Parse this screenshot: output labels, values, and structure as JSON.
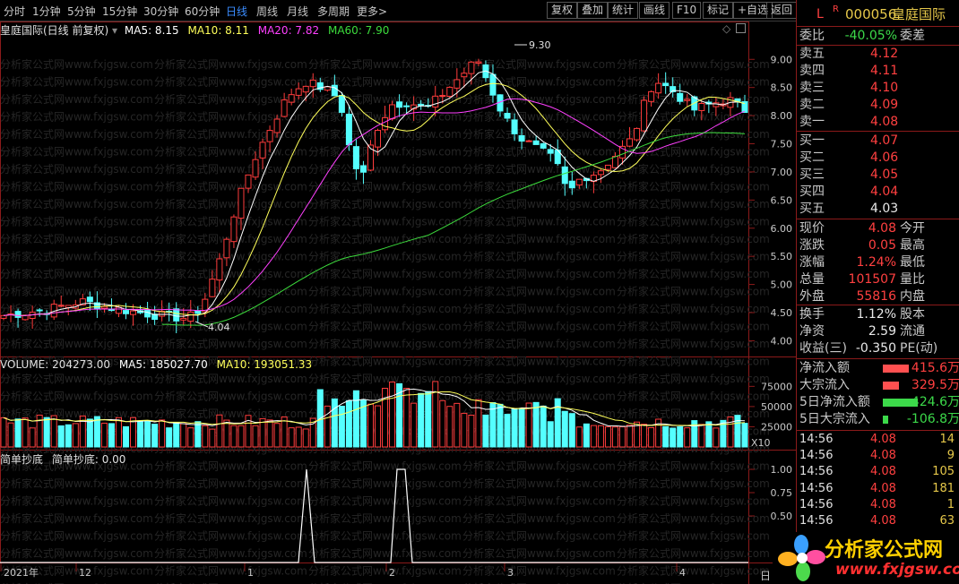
{
  "toolbar": {
    "tabs": [
      "分时",
      "1分钟",
      "5分钟",
      "15分钟",
      "30分钟",
      "60分钟",
      "日线",
      "周线",
      "月线",
      "多周期",
      "更多>"
    ],
    "active_tab": "日线",
    "right_buttons": [
      "复权",
      "叠加",
      "统计",
      "画线",
      "F10",
      "标记",
      "+自选",
      "返回"
    ]
  },
  "main_chart": {
    "title": "皇庭国际(日线 前复权)",
    "ma5_label": "MA5: 8.15",
    "ma10_label": "MA10: 8.11",
    "ma20_label": "MA20: 7.82",
    "ma60_label": "MA60: 7.90",
    "high_marker": "9.30",
    "low_marker": "4.04",
    "y_ticks": [
      "9.00",
      "8.50",
      "8.00",
      "7.50",
      "7.00",
      "6.50",
      "6.00",
      "5.50",
      "5.00",
      "4.50",
      "4.00"
    ],
    "watermark": "分析家公式网www.fxjgsw.com"
  },
  "volume_chart": {
    "volume_label": "VOLUME: 204273.00",
    "ma5_label": "MA5: 185027.70",
    "ma10_label": "MA10: 193051.33",
    "y_ticks": [
      "75000",
      "50000",
      "25000"
    ],
    "unit": "X10"
  },
  "indicator_chart": {
    "name": "简单抄底",
    "value_label": "简单抄底: 0.00",
    "y_ticks": [
      "1.00",
      "0.75",
      "0.50"
    ]
  },
  "x_axis": {
    "labels": [
      "2021年",
      "12",
      "1",
      "2",
      "3",
      "4"
    ],
    "end_label": "日"
  },
  "colors": {
    "up": "#ff3c3c",
    "down": "#54ffff",
    "ma5": "#ffffff",
    "ma10": "#ffff5a",
    "ma20": "#ff40ff",
    "ma60": "#3cdc3c",
    "grid": "#8b1a1a"
  },
  "panel": {
    "code_prefix": "L",
    "code_badge": "R",
    "stock_code": "000056",
    "stock_name": "皇庭国际",
    "weibi_label": "委比",
    "weibi_value": "-40.05%",
    "weicha_label": "委差",
    "sell": [
      {
        "label": "卖五",
        "price": "4.12"
      },
      {
        "label": "卖四",
        "price": "4.11"
      },
      {
        "label": "卖三",
        "price": "4.10"
      },
      {
        "label": "卖二",
        "price": "4.09"
      },
      {
        "label": "卖一",
        "price": "4.08"
      }
    ],
    "buy": [
      {
        "label": "买一",
        "price": "4.07"
      },
      {
        "label": "买二",
        "price": "4.06"
      },
      {
        "label": "买三",
        "price": "4.05"
      },
      {
        "label": "买四",
        "price": "4.04"
      },
      {
        "label": "买五",
        "price": "4.03"
      }
    ],
    "quote": [
      {
        "label": "现价",
        "value": "4.08",
        "label2": "今开"
      },
      {
        "label": "涨跌",
        "value": "0.05",
        "label2": "最高"
      },
      {
        "label": "涨幅",
        "value": "1.24%",
        "label2": "最低"
      },
      {
        "label": "总量",
        "value": "101507",
        "label2": "量比"
      },
      {
        "label": "外盘",
        "value": "55816",
        "label2": "内盘"
      }
    ],
    "stats": [
      {
        "label": "换手",
        "value": "1.12%",
        "label2": "股本"
      },
      {
        "label": "净资",
        "value": "2.59",
        "label2": "流通"
      },
      {
        "label": "收益(三)",
        "value": "-0.350",
        "label2": "PE(动)"
      }
    ],
    "flows": [
      {
        "label": "净流入额",
        "value": "415.6万",
        "color": "red",
        "bar": 0.55
      },
      {
        "label": "大宗流入",
        "value": "329.5万",
        "color": "red",
        "bar": 0.35
      },
      {
        "label": "5日净流入额",
        "value": "-424.6万",
        "color": "grn",
        "bar": 0.75
      },
      {
        "label": "5日大宗流入",
        "value": "-106.8万",
        "color": "grn",
        "bar": 0.12
      }
    ],
    "trades": [
      {
        "time": "14:56",
        "price": "4.08",
        "vol": "14"
      },
      {
        "time": "14:56",
        "price": "4.08",
        "vol": "9"
      },
      {
        "time": "14:56",
        "price": "4.08",
        "vol": "105"
      },
      {
        "time": "14:56",
        "price": "4.08",
        "vol": "181"
      },
      {
        "time": "14:56",
        "price": "4.08",
        "vol": "1"
      },
      {
        "time": "14:56",
        "price": "4.08",
        "vol": "63"
      }
    ]
  },
  "logo": {
    "text": "分析家公式网",
    "url": "www.fxjgsw.com"
  }
}
